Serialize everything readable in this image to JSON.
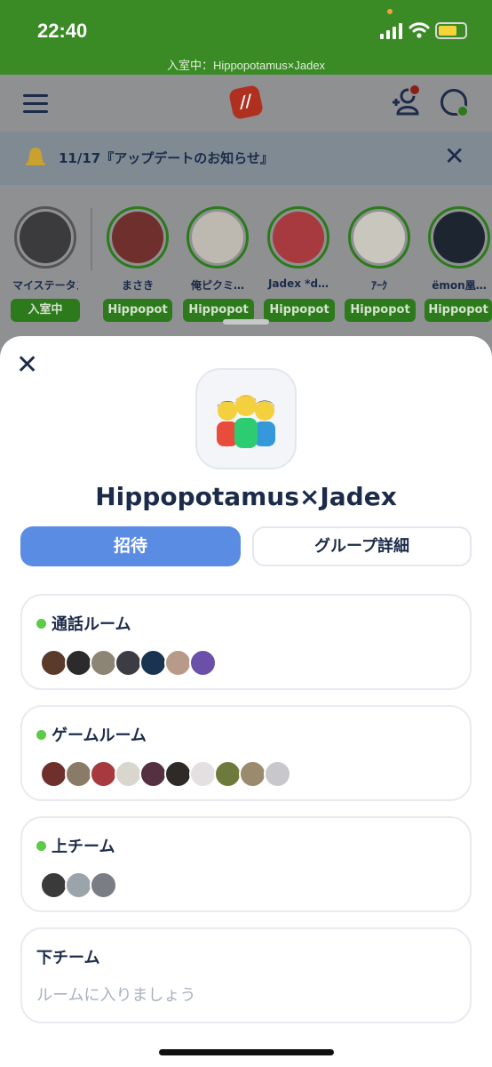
{
  "status_bar": {
    "time": "22:40",
    "subtitle": "入室中：Hippopotamus×Jadex",
    "battery_level": 0.7,
    "colors": {
      "background": "#3a8a26",
      "battery": "#f4d33b"
    }
  },
  "app_header": {
    "logo_text": "//",
    "icons": [
      "menu-icon",
      "logo-icon",
      "add-user-icon",
      "chat-icon"
    ]
  },
  "notice": {
    "text": "11/17『アップデートのお知らせ』",
    "close_glyph": "✕"
  },
  "stories": [
    {
      "name": "マイステータス",
      "tag": "入室中",
      "avatar_color": "#3b3b3d"
    },
    {
      "name": "まさき",
      "tag": "Hippopot",
      "avatar_color": "#6f2f2c"
    },
    {
      "name": "俺ピクミ…",
      "tag": "Hippopot",
      "avatar_color": "#bdb9b1"
    },
    {
      "name": "Jadex *d…",
      "tag": "Hippopot",
      "avatar_color": "#a73a3e"
    },
    {
      "name": "ｱｰｸ",
      "tag": "Hippopot",
      "avatar_color": "#c9c6bd"
    },
    {
      "name": "ëmon凰…",
      "tag": "Hippopot",
      "avatar_color": "#1d2630"
    }
  ],
  "sheet": {
    "close_glyph": "✕",
    "group_title": "Hippopotamus×Jadex",
    "invite_label": "招待",
    "detail_label": "グループ詳細",
    "accent_color": "#5b8ce4"
  },
  "rooms": [
    {
      "title": "通話ルーム",
      "active": true,
      "members": [
        "#5a3a2a",
        "#2b2b2b",
        "#8c8576",
        "#3c3c44",
        "#1a3350",
        "#b89a88",
        "#6a50a8"
      ]
    },
    {
      "title": "ゲームルーム",
      "active": true,
      "members": [
        "#6f2f2c",
        "#8a7a68",
        "#a73a3e",
        "#d9d6ce",
        "#553040",
        "#2e2a28",
        "#e4e0e2",
        "#6e7a3c",
        "#9a8a6e",
        "#c8c8cc"
      ]
    },
    {
      "title": "上チーム",
      "active": true,
      "members": [
        "#3a3a3a",
        "#9aa4aa",
        "#7a7e84"
      ]
    },
    {
      "title": "下チーム",
      "active": false,
      "empty_text": "ルームに入りましょう",
      "members": []
    }
  ]
}
